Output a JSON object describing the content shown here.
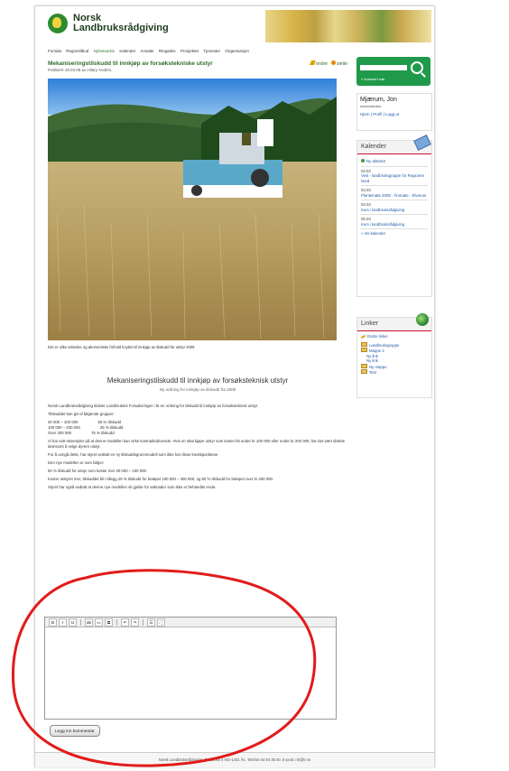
{
  "site": {
    "logo_line1": "Norsk",
    "logo_line2": "Landbruksrådgiving"
  },
  "nav": {
    "items": [
      "Forsida",
      "Regiontilbud",
      "Nyhetsarkiv",
      "Kalender",
      "Ansatte",
      "Ringarkiv",
      "Prosjekter",
      "Tjenester",
      "Organisasjon"
    ],
    "active_index": 2
  },
  "search": {
    "placeholder": "",
    "advanced_label": "» Avansert søk"
  },
  "user": {
    "name": "Mjærum, Jon",
    "role": "Administrator",
    "links": "Hjem | Profil | Logg ut"
  },
  "calendar": {
    "title": "Kalender",
    "new_event": "Ny aktivitet",
    "events": [
      {
        "date": "03.03",
        "title": "Vest - landbruksgruppe for Regionen Nord"
      },
      {
        "date": "04.03",
        "title": "Plantemøte 2008 · Årsmøte · Elverum"
      },
      {
        "date": "04.03",
        "title": "Kurs i landbruksrådgiving"
      },
      {
        "date": "05.03",
        "title": "Kurs i landbruksrådgiving"
      }
    ],
    "view_all": "» Vis kalender"
  },
  "links": {
    "title": "Linker",
    "edit": "Endre linker",
    "items": [
      "Landbruksgruppe",
      "Mappe 2",
      "Ny link",
      "Ny link",
      "Ny mappe",
      "Test"
    ]
  },
  "article": {
    "title": "Mekaniseringstilskudd til innkjøp av forsøkstekniske utstyr",
    "published": "Publisert 18.03.08 av Hilary Anders.",
    "edit_label": "endre",
    "delete_label": "slette",
    "caption": "Det er ulike tekniske og økonomiske forhold knyttet til innkjøp av tilskudd for utstyr 2008",
    "intro_title": "Mekaniseringstilskudd til innkjøp av forsøksteknisk utstyr",
    "intro_subtitle": "Ny ordning for innkjøp av tilskudd fra 2008",
    "paragraphs": [
      "Norsk Landbruksrådgiving tildeler Landbrukets Forsøksringer i år en ordning for tilskudd til innkjøp av forsøksteknisk utstyr.",
      "Tilskuddet kan gis til følgende grupper:"
    ],
    "rates": [
      {
        "range": "20 000 – 100 000",
        "pct": "50 % tilskudd"
      },
      {
        "range": "100 000 – 200 000",
        "pct": "25 % tilskudd"
      },
      {
        "range": "Over 200 000",
        "pct": "75 % tilskudd"
      }
    ],
    "paragraphs2": [
      "Vi har sett eksempler på at denne modellen kan virke kostnadsdrivende. Hvis en skal kjøpe utstyr som koster litt under kr 100 000 eller under kr 200 000, har det vært direkte lønnsomt å velge dyrere utstyr.",
      "For å unngå dette, har styret vedtatt en ny tilskuddsgrunnmodell som ikke har disse knekkpunktene.",
      "Den nye modellen er som følger:",
      "50 % tilskudd for utstyr som koster mer 20 000 – 100 000.",
      "Koster utstyret mer, tilskuddet bli i tillegg 25 % tilskudd for beløpet 100 000 – 400 000, og 50 % tilskudd for beløpet over kr 400 000.",
      "Styret har også vedtatt at denne nye modellen vil gjelde for søknader som ikke er behandlet enda."
    ]
  },
  "comments": {
    "heading": "Kommentarer",
    "none": "Ingen kommentarer"
  },
  "editor": {
    "toolbar": [
      "B",
      "I",
      "U",
      "ab",
      "▭",
      "⧉",
      "↶",
      "↷",
      "☰",
      "⛶"
    ]
  },
  "submit_label": "Legg inn kommentar",
  "footer": "Norsk Landbruksrådgiving, Postboks 4 NO-1431 Ås. Telefon 64 94 35 00. E-post: nlr@lr.no"
}
